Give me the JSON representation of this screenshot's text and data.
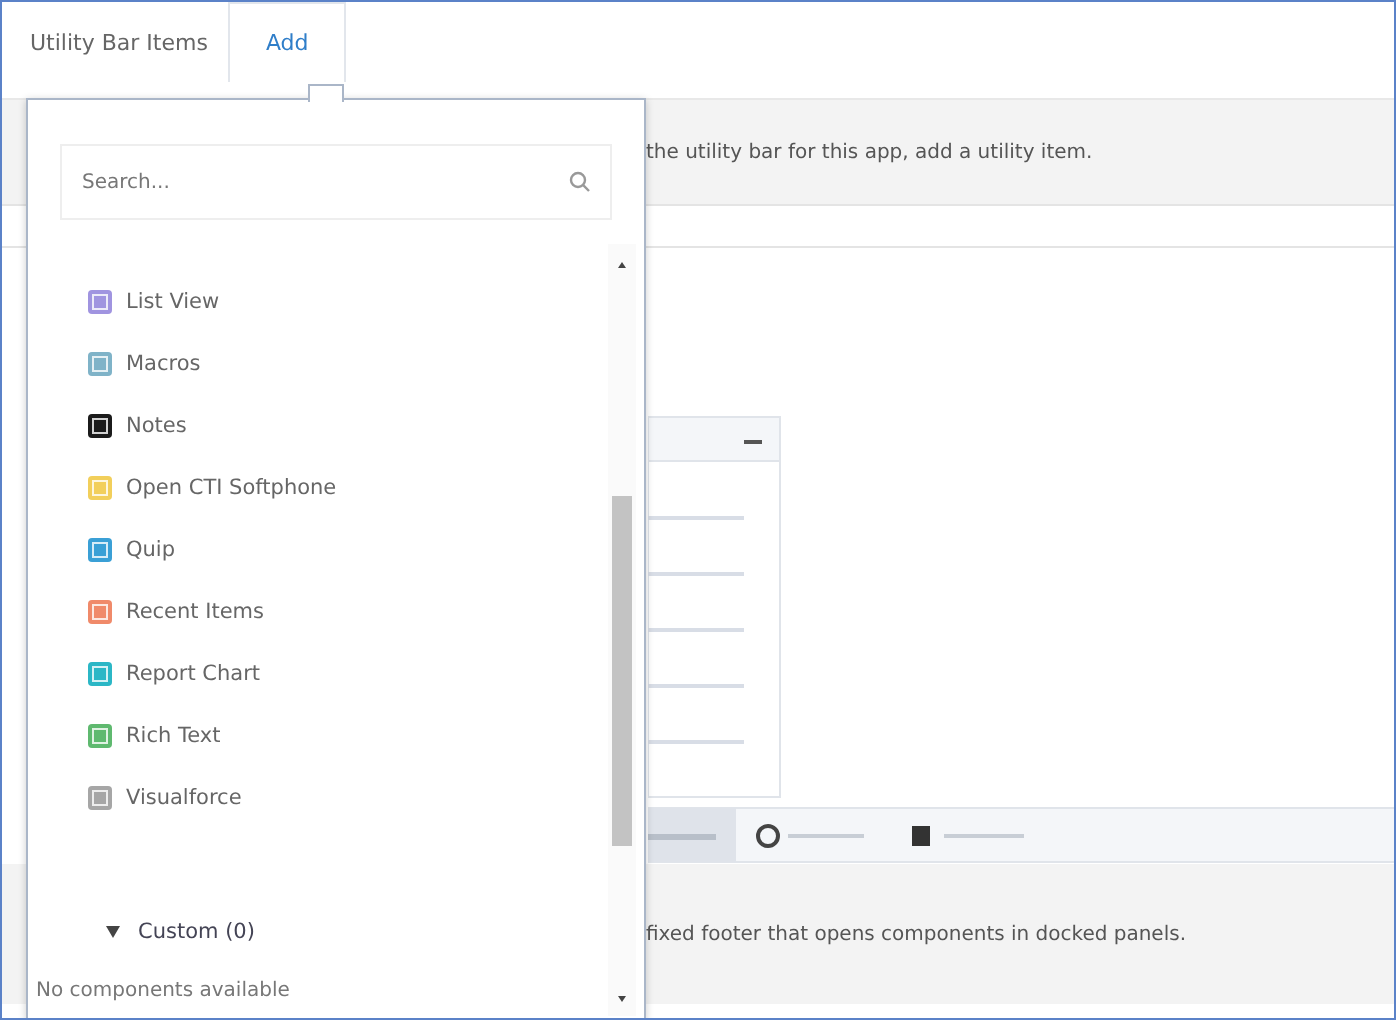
{
  "tabs": [
    {
      "label": "Utility Bar Items",
      "selected": false
    },
    {
      "label": "Add",
      "selected": true
    }
  ],
  "banner": {
    "text": "the utility bar for this app, add a utility item."
  },
  "footer_note": {
    "text": "fixed footer that opens components in docked panels."
  },
  "dropdown": {
    "search": {
      "placeholder": "Search..."
    },
    "items": [
      {
        "label": "List View",
        "color": "#a094e0"
      },
      {
        "label": "Macros",
        "color": "#7fb3c8"
      },
      {
        "label": "Notes",
        "color": "#1b1b1b"
      },
      {
        "label": "Open CTI Softphone",
        "color": "#f2cf5b"
      },
      {
        "label": "Quip",
        "color": "#3aa0d6"
      },
      {
        "label": "Recent Items",
        "color": "#f08a6a"
      },
      {
        "label": "Report Chart",
        "color": "#2bb7c6"
      },
      {
        "label": "Rich Text",
        "color": "#5fb96f"
      },
      {
        "label": "Visualforce",
        "color": "#a6a6a6"
      }
    ],
    "section": {
      "label": "Custom (0)",
      "expanded": true,
      "empty_text": "No components available"
    }
  }
}
